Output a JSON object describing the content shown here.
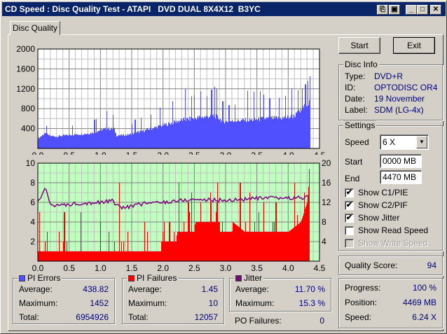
{
  "window": {
    "title": "CD Speed : Disc Quality Test - ATAPI   DVD DUAL 8X4X12  B3YC",
    "controls": [
      "copy-icon",
      "save-icon",
      "minimize-icon",
      "maximize-icon",
      "close-icon"
    ]
  },
  "tabs": [
    {
      "label": "Disc Quality",
      "active": true
    }
  ],
  "buttons": {
    "start": "Start",
    "exit": "Exit"
  },
  "disc_info": {
    "title": "Disc Info",
    "rows": [
      {
        "label": "Type:",
        "value": "DVD+R"
      },
      {
        "label": "ID:",
        "value": "OPTODISC OR4"
      },
      {
        "label": "Date:",
        "value": "19 November"
      },
      {
        "label": "Label:",
        "value": "SDM (LG-4x)"
      }
    ]
  },
  "settings": {
    "title": "Settings",
    "speed_label": "Speed",
    "speed_value": "6 X",
    "start_label": "Start",
    "start_value": "0000 MB",
    "end_label": "End",
    "end_value": "4470 MB",
    "checks": [
      {
        "label": "Show C1/PIE",
        "checked": true,
        "enabled": true
      },
      {
        "label": "Show C2/PIF",
        "checked": true,
        "enabled": true
      },
      {
        "label": "Show Jitter",
        "checked": true,
        "enabled": true
      },
      {
        "label": "Show Read Speed",
        "checked": false,
        "enabled": true
      },
      {
        "label": "Show Write Speed",
        "checked": false,
        "enabled": false
      }
    ]
  },
  "quality": {
    "label": "Quality Score:",
    "value": "94"
  },
  "progress": {
    "rows": [
      {
        "label": "Progress:",
        "value": "100 %"
      },
      {
        "label": "Position:",
        "value": "4469 MB"
      },
      {
        "label": "Speed:",
        "value": "6.24 X"
      }
    ]
  },
  "pi_errors": {
    "title": "PI Errors",
    "color": "#5050ff",
    "rows": [
      {
        "label": "Average:",
        "value": "438.82"
      },
      {
        "label": "Maximum:",
        "value": "1452"
      },
      {
        "label": "Total:",
        "value": "6954926"
      }
    ]
  },
  "pi_failures": {
    "title": "PI Failures",
    "color": "#ff0000",
    "rows": [
      {
        "label": "Average:",
        "value": "1.45"
      },
      {
        "label": "Maximum:",
        "value": "10"
      },
      {
        "label": "Total:",
        "value": "12057"
      }
    ]
  },
  "jitter": {
    "title": "Jitter",
    "color": "#800080",
    "rows": [
      {
        "label": "Average:",
        "value": "11.70 %"
      },
      {
        "label": "Maximum:",
        "value": "15.3 %"
      }
    ]
  },
  "po_failures": {
    "label": "PO Failures:",
    "value": "0"
  },
  "chart_data": [
    {
      "type": "bar",
      "series": "PI Errors",
      "color": "#5050ff",
      "background": "#ffffff",
      "xlim": [
        0,
        4.5
      ],
      "ylim": [
        0,
        2000
      ],
      "xticks": [
        "0.0",
        "0.5",
        "1.0",
        "1.5",
        "2.0",
        "2.5",
        "3.0",
        "3.5",
        "4.0",
        "4.5"
      ],
      "yticks": [
        "400",
        "800",
        "1200",
        "1600",
        "2000"
      ],
      "grid": true,
      "baseline": [
        [
          0,
          200
        ],
        [
          0.1,
          300
        ],
        [
          0.2,
          250
        ],
        [
          0.3,
          240
        ],
        [
          0.4,
          260
        ],
        [
          0.5,
          270
        ],
        [
          0.6,
          280
        ],
        [
          0.7,
          290
        ],
        [
          0.8,
          300
        ],
        [
          0.9,
          330
        ],
        [
          1.0,
          370
        ],
        [
          1.1,
          400
        ],
        [
          1.22,
          390
        ],
        [
          1.25,
          260
        ],
        [
          1.4,
          270
        ],
        [
          1.5,
          290
        ],
        [
          1.6,
          330
        ],
        [
          1.7,
          360
        ],
        [
          1.8,
          400
        ],
        [
          1.9,
          430
        ],
        [
          2.0,
          470
        ],
        [
          2.1,
          500
        ],
        [
          2.2,
          540
        ],
        [
          2.3,
          570
        ],
        [
          2.4,
          590
        ],
        [
          2.5,
          610
        ],
        [
          2.6,
          630
        ],
        [
          2.7,
          640
        ],
        [
          2.8,
          660
        ],
        [
          2.88,
          620
        ],
        [
          2.95,
          540
        ],
        [
          3.1,
          550
        ],
        [
          3.2,
          560
        ],
        [
          3.3,
          570
        ],
        [
          3.4,
          570
        ],
        [
          3.5,
          580
        ],
        [
          3.6,
          600
        ],
        [
          3.8,
          610
        ],
        [
          3.9,
          610
        ],
        [
          4.0,
          630
        ],
        [
          4.1,
          660
        ],
        [
          4.2,
          760
        ],
        [
          4.3,
          900
        ],
        [
          4.35,
          900
        ]
      ],
      "spikes": [
        [
          0.13,
          460
        ],
        [
          0.55,
          460
        ],
        [
          0.9,
          580
        ],
        [
          0.93,
          590
        ],
        [
          1.1,
          750
        ],
        [
          1.2,
          680
        ],
        [
          1.5,
          490
        ],
        [
          1.55,
          580
        ],
        [
          1.65,
          620
        ],
        [
          1.8,
          680
        ],
        [
          1.95,
          820
        ],
        [
          2.15,
          950
        ],
        [
          2.35,
          1200
        ],
        [
          2.45,
          1050
        ],
        [
          2.5,
          1070
        ],
        [
          2.6,
          1150
        ],
        [
          2.7,
          1050
        ],
        [
          2.77,
          1180
        ],
        [
          2.82,
          1240
        ],
        [
          2.85,
          1200
        ],
        [
          2.95,
          950
        ],
        [
          3.05,
          870
        ],
        [
          3.15,
          880
        ],
        [
          3.35,
          1160
        ],
        [
          3.45,
          1140
        ],
        [
          3.55,
          1150
        ],
        [
          3.6,
          1080
        ],
        [
          3.7,
          1010
        ],
        [
          3.85,
          1020
        ],
        [
          3.95,
          1060
        ],
        [
          4.05,
          1200
        ],
        [
          4.15,
          1170
        ],
        [
          4.22,
          1200
        ],
        [
          4.27,
          1290
        ],
        [
          4.31,
          1360
        ],
        [
          4.34,
          1452
        ]
      ]
    },
    {
      "type": "bar",
      "series": "PI Failures",
      "color": "#ff0000",
      "background": "#c0ffc0",
      "xlim": [
        0,
        4.5
      ],
      "ylim": [
        0,
        10
      ],
      "y2lim": [
        0,
        20
      ],
      "xticks": [
        "0.0",
        "0.5",
        "1.0",
        "1.5",
        "2.0",
        "2.5",
        "3.0",
        "3.5",
        "4.0",
        "4.5"
      ],
      "yticks": [
        "2",
        "4",
        "6",
        "8",
        "10"
      ],
      "y2ticks": [
        "4",
        "8",
        "12",
        "16",
        "20"
      ],
      "grid": true,
      "baseline": [
        [
          0,
          1
        ],
        [
          1.96,
          1
        ],
        [
          1.97,
          2
        ],
        [
          2.21,
          2
        ],
        [
          2.22,
          3
        ],
        [
          2.5,
          3
        ],
        [
          2.51,
          4
        ],
        [
          2.9,
          4
        ],
        [
          2.91,
          3
        ],
        [
          3.1,
          3
        ],
        [
          3.11,
          4
        ],
        [
          3.3,
          3
        ],
        [
          4.0,
          3
        ],
        [
          4.2,
          4
        ],
        [
          4.3,
          6
        ],
        [
          4.34,
          9
        ]
      ],
      "spikes": [
        [
          0.02,
          5
        ],
        [
          0.42,
          5
        ],
        [
          0.68,
          5
        ],
        [
          1.3,
          8
        ],
        [
          1.0,
          4
        ],
        [
          1.7,
          4
        ],
        [
          2.1,
          4
        ],
        [
          2.25,
          8
        ],
        [
          2.4,
          6
        ],
        [
          2.45,
          7
        ],
        [
          2.6,
          6
        ],
        [
          2.75,
          7
        ],
        [
          2.87,
          8
        ],
        [
          3.23,
          8
        ],
        [
          3.38,
          7
        ],
        [
          3.6,
          6
        ],
        [
          3.8,
          6
        ],
        [
          4.1,
          8
        ],
        [
          4.25,
          7
        ],
        [
          4.35,
          10
        ]
      ],
      "jitter": {
        "color": "#800080",
        "axis": "right",
        "points": [
          [
            0,
            12.2
          ],
          [
            0.13,
            14.8
          ],
          [
            0.2,
            11.6
          ],
          [
            0.4,
            11.3
          ],
          [
            0.6,
            11.8
          ],
          [
            1.0,
            12
          ],
          [
            1.2,
            12.3
          ],
          [
            1.3,
            10.9
          ],
          [
            1.5,
            11.2
          ],
          [
            1.7,
            11.8
          ],
          [
            2.0,
            12
          ],
          [
            2.2,
            12.3
          ],
          [
            2.5,
            12.6
          ],
          [
            3.0,
            12.4
          ],
          [
            3.5,
            12.8
          ],
          [
            4.0,
            12.9
          ],
          [
            4.35,
            13
          ]
        ]
      }
    }
  ]
}
